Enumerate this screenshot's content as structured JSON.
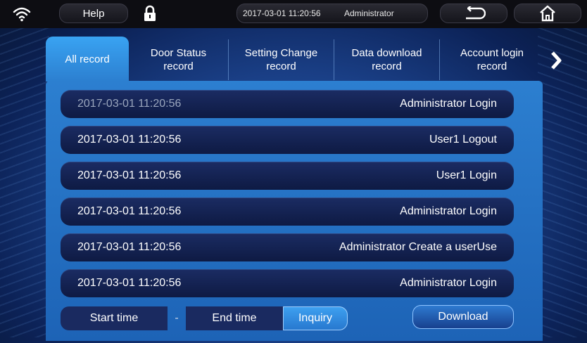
{
  "topbar": {
    "help_label": "Help",
    "datetime": "2017-03-01  11:20:56",
    "user": "Administrator"
  },
  "tabs": [
    {
      "label": "All record",
      "active": true
    },
    {
      "label": "Door Status\nrecord",
      "active": false
    },
    {
      "label": "Setting Change\nrecord",
      "active": false
    },
    {
      "label": "Data download\nrecord",
      "active": false
    },
    {
      "label": "Account login\nrecord",
      "active": false
    }
  ],
  "records": [
    {
      "time": "2017-03-01  11:20:56",
      "event": "Administrator Login"
    },
    {
      "time": "2017-03-01  11:20:56",
      "event": "User1 Logout"
    },
    {
      "time": "2017-03-01  11:20:56",
      "event": "User1 Login"
    },
    {
      "time": "2017-03-01  11:20:56",
      "event": "Administrator Login"
    },
    {
      "time": "2017-03-01  11:20:56",
      "event": "Administrator Create a userUse"
    },
    {
      "time": "2017-03-01  11:20:56",
      "event": "Administrator Login"
    }
  ],
  "filter": {
    "start_label": "Start time",
    "dash": "-",
    "end_label": "End time",
    "inquiry_label": "Inquiry",
    "download_label": "Download"
  },
  "colors": {
    "accent": "#39a3f2",
    "row_bg": "#14234f",
    "topbar_bg": "#0d0d12"
  },
  "icons": {
    "wifi": "wifi-icon",
    "lock": "lock-icon",
    "back": "back-arrow-icon",
    "home": "home-icon",
    "next": "chevron-right-icon"
  }
}
